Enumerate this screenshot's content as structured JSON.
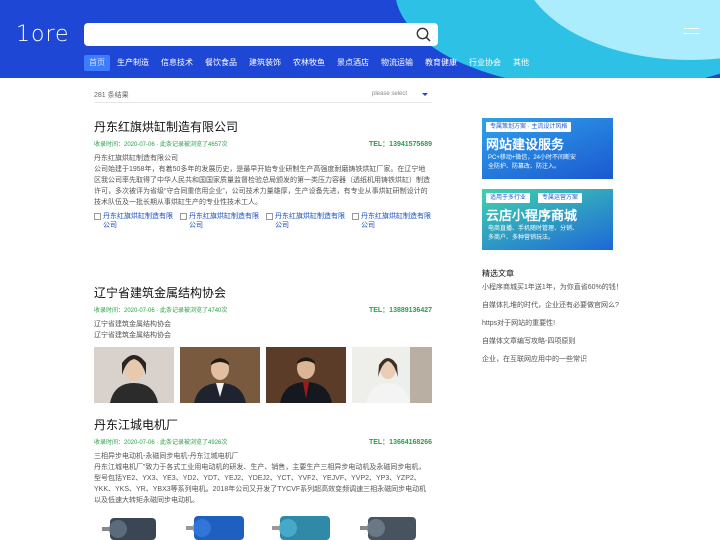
{
  "header": {
    "logo": "1ore",
    "search": {
      "placeholder": ""
    },
    "nav": [
      "首页",
      "生产制造",
      "信息技术",
      "餐饮食品",
      "建筑装饰",
      "农林牧鱼",
      "景点酒店",
      "物流运输",
      "教育健康",
      "行业协会",
      "其他"
    ],
    "active_nav": "首页"
  },
  "results": {
    "count": "281 条结果",
    "sort_placeholder": "please select"
  },
  "items": [
    {
      "title": "丹东红旗烘缸制造有限公司",
      "meta": "收录时间：2020-07-06 · 此条记录被浏览了4657次",
      "phone": "TEL：13941575689",
      "lines": [
        "丹东红旗烘缸制造有限公司",
        "公司始建于1958年，有着50多年的发展历史，是最早开始专业研制生产高强度耐磨铸铁烘缸厂家。在辽宁地区我公司率先取得了中华人民共和国国家质量监督检验总局颁发的第一类压力容器（透纸机用铸铁烘缸）制造许可，多次被评为省级“守合同重信用企业”，公司技术力量雄厚，生产设备先进，有专业从事烘缸研制设计的技术队伍及一批长期从事烘缸生产的专业性技术工人。"
      ],
      "image_alts": [
        "丹东红旗烘缸制造有限公司",
        "丹东红旗烘缸制造有限公司",
        "丹东红旗烘缸制造有限公司",
        "丹东红旗烘缸制造有限公司"
      ]
    },
    {
      "title": "辽宁省建筑金属结构协会",
      "meta": "收录时间：2020-07-06 · 此条记录被浏览了4740次",
      "phone": "TEL：13889136427",
      "lines": [
        "辽宁省建筑金属结构协会",
        "辽宁省建筑金属结构协会"
      ]
    },
    {
      "title": "丹东江城电机厂",
      "meta": "收录时间：2020-07-06 · 此条记录被浏览了4926次",
      "phone": "TEL：13664168266",
      "lines": [
        "三相异步电动机-永磁同步电机-丹东江城电机厂",
        "丹东江城电机厂”致力于各式工业用电动机的研发、生产、销售，主要生产三相异步电动机及永磁同步电机，型号包括YE2、YX3、YE3、YD2、YDT、YEJ2、YDEJ2、YCT、YVF2、YEJVF、YVP2、YP3、YZP2、YKK、YKS、YR、YBX3等系列电机。2018年公司又开发了TYCVF系列超高效变频调速三相永磁同步电动机以及低速大转矩永磁同步电动机。"
      ]
    }
  ],
  "sidebar": {
    "banner1": {
      "tag": "专属策划方案 · 主流设计风格",
      "title": "网站建设服务",
      "sub": "PC+移动+微信，24小时不间断安全防护、防篡改、防注入。"
    },
    "banner2": {
      "tag1": "适用于多行业",
      "tag2": "专属运营方案",
      "title": "云店小程序商城",
      "sub": "电商直播、手机随时管理、分销、多商户、多种营销玩法。"
    },
    "section_title": "精选文章",
    "articles": [
      "小程序商城买1年送1年，为你直省60%的钱！",
      "自媒体扎堆的时代，企业还有必要做官网么?",
      "https对于网站的重要性!",
      "自媒体文章编写攻略-四项原则",
      "企业，在互联网应用中的一些常识"
    ]
  },
  "colors": {
    "header_bg": "#1e47d6",
    "accent_green": "#2aa046",
    "link_blue": "#1a4fbf"
  }
}
